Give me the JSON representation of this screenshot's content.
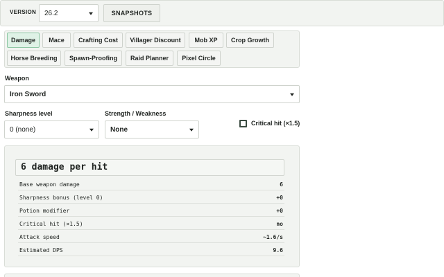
{
  "version": {
    "label": "VERSION",
    "value": "26.2"
  },
  "snapshots_label": "SNAPSHOTS",
  "tabs": [
    {
      "label": "Damage",
      "active": true
    },
    {
      "label": "Mace"
    },
    {
      "label": "Crafting Cost"
    },
    {
      "label": "Villager Discount"
    },
    {
      "label": "Mob XP"
    },
    {
      "label": "Crop Growth"
    },
    {
      "label": "Horse Breeding"
    },
    {
      "label": "Spawn-Proofing"
    },
    {
      "label": "Raid Planner"
    },
    {
      "label": "Pixel Circle"
    }
  ],
  "weapon": {
    "label": "Weapon",
    "value": "Iron Sword"
  },
  "sharpness": {
    "label": "Sharpness level",
    "value": "0 (none)"
  },
  "strength": {
    "label": "Strength / Weakness",
    "value": "None"
  },
  "critical": {
    "label": "Critical hit (×1.5)",
    "checked": false
  },
  "result": {
    "headline": "6 damage per hit",
    "rows": [
      {
        "label": "Base weapon damage",
        "value": "6"
      },
      {
        "label": "Sharpness bonus (level 0)",
        "value": "+0"
      },
      {
        "label": "Potion modifier",
        "value": "+0"
      },
      {
        "label": "Critical hit (×1.5)",
        "value": "no"
      },
      {
        "label": "Attack speed",
        "value": "~1.6/s"
      },
      {
        "label": "Estimated DPS",
        "value": "9.6"
      }
    ]
  },
  "colors": {
    "active_tab_bg": "#dff2e6",
    "active_tab_border": "#8cc7a2",
    "panel_bg": "#f2f4f1"
  }
}
